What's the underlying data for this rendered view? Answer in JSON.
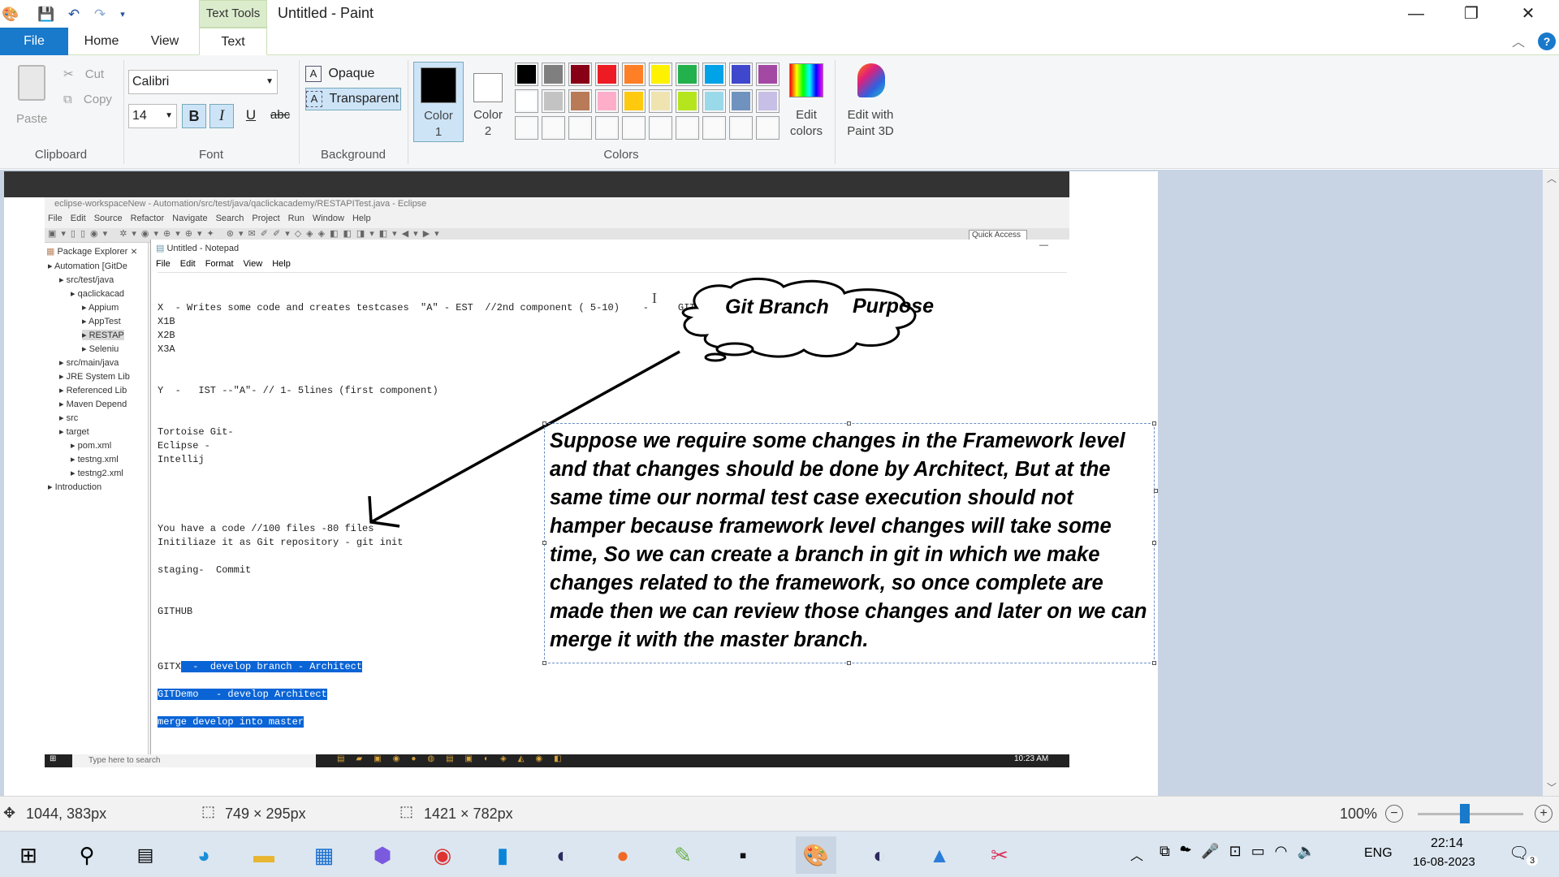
{
  "window": {
    "title": "Untitled - Paint",
    "context_tab_group": "Text Tools",
    "minimize_glyph": "—",
    "maximize_glyph": "❐",
    "close_glyph": "✕"
  },
  "tabs": {
    "file": "File",
    "home": "Home",
    "view": "View",
    "text": "Text"
  },
  "ribbon": {
    "clipboard": {
      "label": "Clipboard",
      "paste": "Paste",
      "cut": "Cut",
      "copy": "Copy"
    },
    "font": {
      "label": "Font",
      "family": "Calibri",
      "size": "14",
      "bold": "B",
      "italic": "I",
      "underline": "U",
      "strike": "abc"
    },
    "background": {
      "label": "Background",
      "opaque": "Opaque",
      "transparent": "Transparent"
    },
    "colors": {
      "label": "Colors",
      "color1": "Color\n1",
      "color2": "Color\n2",
      "edit_colors": "Edit\ncolors",
      "edit_paint3d": "Edit with\nPaint 3D",
      "color1_value": "#000000",
      "color2_value": "#ffffff",
      "row1": [
        "#000000",
        "#7f7f7f",
        "#880015",
        "#ed1c24",
        "#ff7f27",
        "#fff200",
        "#22b14c",
        "#00a2e8",
        "#3f48cc",
        "#a349a4"
      ],
      "row2": [
        "#ffffff",
        "#c3c3c3",
        "#b97a57",
        "#ffaec9",
        "#ffc90e",
        "#efe4b0",
        "#b5e61d",
        "#99d9ea",
        "#7092be",
        "#c8bfe7"
      ],
      "row3": [
        "#ffffff",
        "#ffffff",
        "#ffffff",
        "#ffffff",
        "#ffffff",
        "#ffffff",
        "#ffffff",
        "#ffffff",
        "#ffffff",
        "#ffffff"
      ]
    }
  },
  "eclipse": {
    "title": "eclipse-workspaceNew - Automation/src/test/java/qaclickacademy/RESTAPITest.java - Eclipse",
    "menu": [
      "File",
      "Edit",
      "Source",
      "Refactor",
      "Navigate",
      "Search",
      "Project",
      "Run",
      "Window",
      "Help"
    ],
    "quick_access": "Quick Access",
    "package_explorer": "Package Explorer",
    "tree": [
      "Automation [GitDe",
      "src/test/java",
      "qaclickacad",
      "Appium",
      "AppTest",
      "RESTAP",
      "Seleniu",
      "src/main/java",
      "JRE System Lib",
      "Referenced Lib",
      "Maven Depend",
      "src",
      "target",
      "pom.xml",
      "testng.xml",
      "testng2.xml",
      "Introduction"
    ]
  },
  "notepad": {
    "title": "Untitled - Notepad",
    "menu": [
      "File",
      "Edit",
      "Format",
      "View",
      "Help"
    ],
    "lines": [
      "X  - Writes some code and creates testcases  \"A\" - EST  //2nd component ( 5-10)    -     GITHUB",
      "X1B",
      "X2B",
      "X3A",
      "Y  -   IST --\"A\"- // 1- 5lines (first component)",
      "Tortoise Git-",
      "Eclipse -",
      "Intellij",
      "You have a code //100 files -80 files",
      "Initiliaze it as Git repository - git init",
      "staging-  Commit",
      "GITHUB",
      "GITX",
      "  -  develop branch - Architect",
      "GITDemo   - develop Architect",
      "merge develop into master"
    ]
  },
  "taskbar_embedded": {
    "search": "Type here to search",
    "time": "10:23 AM"
  },
  "annotation": {
    "cloud_text_1": "Git Branch",
    "cloud_text_2": "Purpose",
    "paragraph": "Suppose we require some changes in the Framework level and that changes should be done by Architect, But at the same time our normal test case execution should not hamper because framework level changes will take some time, So we can create a branch in git in which we make changes related to the framework, so once complete are made then we can review those changes and later on we can merge it with the master branch."
  },
  "status": {
    "cursor": "1044, 383px",
    "selection": "749 × 295px",
    "canvas_size": "1421 × 782px",
    "zoom": "100%",
    "zoom_level": 1.0
  },
  "taskbar": {
    "lang": "ENG",
    "time": "22:14",
    "date": "16-08-2023",
    "notifications": "3"
  }
}
